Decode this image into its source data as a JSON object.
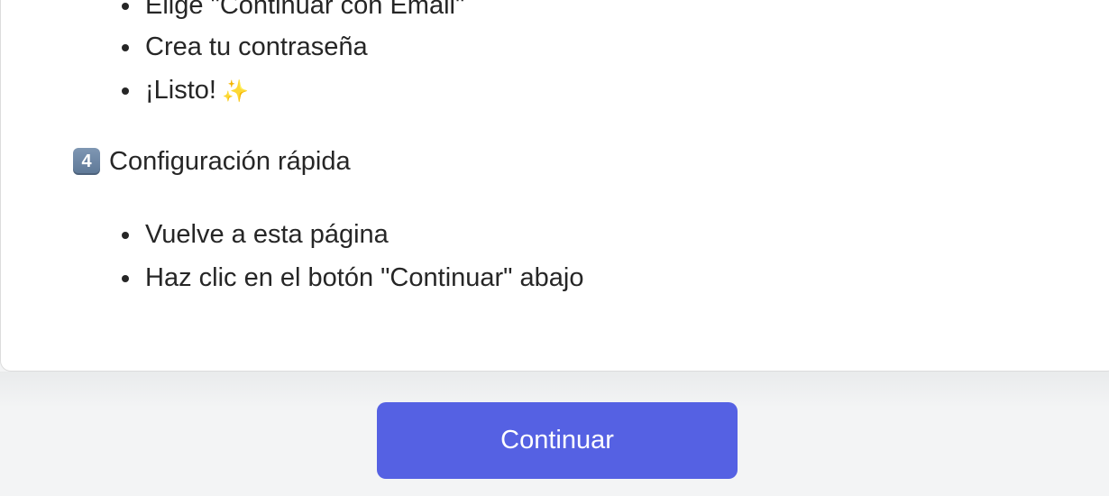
{
  "step3": {
    "items": [
      "Elige \"Continuar con Email\"",
      "Crea tu contraseña",
      "¡Listo!"
    ],
    "sparkle": "✨"
  },
  "step4": {
    "number": "4",
    "heading": "Configuración rápida",
    "items": [
      "Vuelve a esta página",
      "Haz clic en el botón \"Continuar\" abajo"
    ]
  },
  "footer": {
    "continue_label": "Continuar"
  },
  "colors": {
    "primary_button": "#5561e3",
    "sparkle": "#f2c14e",
    "keycap": "#6b85a4"
  }
}
